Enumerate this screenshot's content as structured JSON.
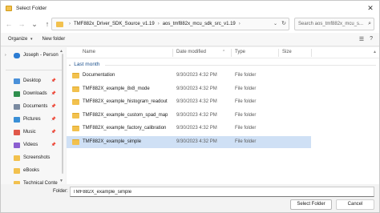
{
  "window": {
    "title": "Select Folder",
    "close_glyph": "✕"
  },
  "nav": {
    "back_glyph": "←",
    "forward_glyph": "→",
    "dropdown_glyph": "⌄",
    "up_glyph": "↑",
    "address": {
      "crumbs": [
        "TMF882x_Driver_SDK_Source_v1.19",
        "aos_tmf882x_mcu_sdk_src_v1.19"
      ],
      "separator": "›",
      "dropdown_glyph": "⌄",
      "refresh_glyph": "↻"
    },
    "search": {
      "placeholder": "Search aos_tmf882x_mcu_s...",
      "icon": "⌕"
    }
  },
  "commands": {
    "organize": "Organize",
    "new_folder": "New folder",
    "caret": "▾",
    "view_glyph": "☰",
    "help_glyph": "?"
  },
  "sidebar": {
    "top_item": {
      "label": "Joseph - Person",
      "expander": "›"
    },
    "scroll_up": "▲",
    "scroll_down": "▼",
    "pin_glyph": "📌",
    "items": [
      {
        "label": "Desktop",
        "icon": "desktop-icon",
        "color": "#4a90d9",
        "pinned": true
      },
      {
        "label": "Downloads",
        "icon": "download-icon",
        "color": "#2f8f4e",
        "pinned": true
      },
      {
        "label": "Documents",
        "icon": "document-icon",
        "color": "#7a8aa0",
        "pinned": true
      },
      {
        "label": "Pictures",
        "icon": "pictures-icon",
        "color": "#3a8fd6",
        "pinned": true
      },
      {
        "label": "Music",
        "icon": "music-icon",
        "color": "#e0584a",
        "pinned": true
      },
      {
        "label": "Videos",
        "icon": "videos-icon",
        "color": "#8b5fd0",
        "pinned": true
      },
      {
        "label": "Screenshots",
        "icon": "folder-icon",
        "color": "#f2c14e",
        "pinned": false
      },
      {
        "label": "eBooks",
        "icon": "folder-icon",
        "color": "#f2c14e",
        "pinned": false
      },
      {
        "label": "Technical Conte",
        "icon": "folder-icon",
        "color": "#f2c14e",
        "pinned": false
      }
    ]
  },
  "list": {
    "columns": {
      "name": "Name",
      "date": "Date modified",
      "type": "Type",
      "size": "Size"
    },
    "sort_glyph": "^",
    "group": {
      "label": "Last month",
      "chevron": "⌄"
    },
    "rows": [
      {
        "name": "Documentation",
        "date": "9/30/2023 4:32 PM",
        "type": "File folder",
        "selected": false
      },
      {
        "name": "TMF882X_example_8x8_mode",
        "date": "9/30/2023 4:32 PM",
        "type": "File folder",
        "selected": false
      },
      {
        "name": "TMF882X_example_histogram_readout",
        "date": "9/30/2023 4:32 PM",
        "type": "File folder",
        "selected": false
      },
      {
        "name": "TMF882X_example_custom_spad_map",
        "date": "9/30/2023 4:32 PM",
        "type": "File folder",
        "selected": false
      },
      {
        "name": "TMF882X_example_factory_calibration",
        "date": "9/30/2023 4:32 PM",
        "type": "File folder",
        "selected": false
      },
      {
        "name": "TMF882X_example_simple",
        "date": "9/30/2023 4:32 PM",
        "type": "File folder",
        "selected": true
      }
    ],
    "scroll_glyph": "▲"
  },
  "footer": {
    "folder_label": "Folder:",
    "folder_value": "TMF882X_example_simple",
    "select_button": "Select Folder",
    "cancel_button": "Cancel"
  }
}
